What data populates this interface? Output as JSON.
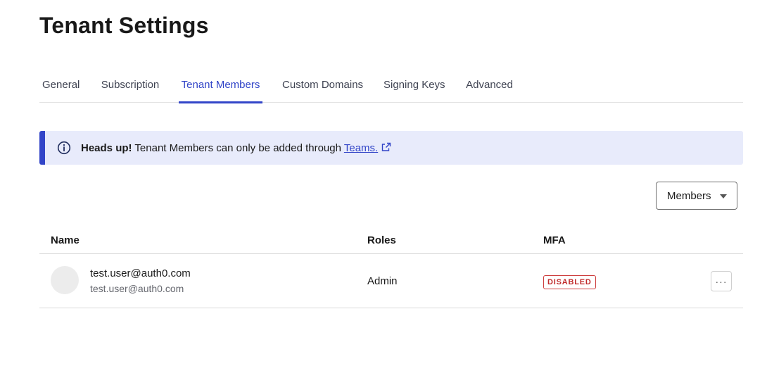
{
  "page": {
    "title": "Tenant Settings"
  },
  "tabs": [
    {
      "label": "General"
    },
    {
      "label": "Subscription"
    },
    {
      "label": "Tenant Members",
      "active": true
    },
    {
      "label": "Custom Domains"
    },
    {
      "label": "Signing Keys"
    },
    {
      "label": "Advanced"
    }
  ],
  "alert": {
    "icon": "info-icon",
    "title": "Heads up!",
    "message": "Tenant Members can only be added through",
    "link_text": "Teams.",
    "link_icon": "external-link-icon"
  },
  "filter": {
    "selected": "Members"
  },
  "table": {
    "columns": [
      "Name",
      "Roles",
      "MFA"
    ],
    "rows": [
      {
        "name": "test.user@auth0.com",
        "email": "test.user@auth0.com",
        "role": "Admin",
        "mfa": "DISABLED",
        "actions_icon": "more-horizontal-icon"
      }
    ]
  },
  "colors": {
    "accent": "#3245c8",
    "alert_bg": "#e8ebfb",
    "danger": "#c02b2b"
  }
}
